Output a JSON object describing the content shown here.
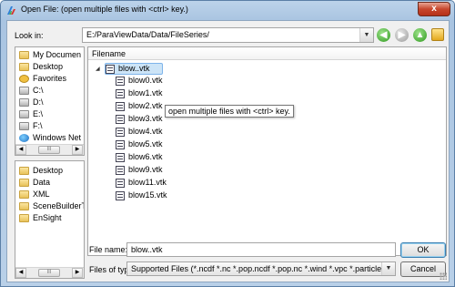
{
  "window": {
    "title": "Open File:  (open multiple files with <ctrl> key.)",
    "close_glyph": "x"
  },
  "toolbar": {
    "look_in_label": "Look in:",
    "look_in_value": "E:/ParaViewData/Data/FileSeries/",
    "back_glyph": "◀",
    "forward_glyph": "▶",
    "up_glyph": "▲"
  },
  "places": {
    "items": [
      {
        "label": "My Documen",
        "icon": "folder"
      },
      {
        "label": "Desktop",
        "icon": "folder"
      },
      {
        "label": "Favorites",
        "icon": "star"
      },
      {
        "label": "C:\\",
        "icon": "drive"
      },
      {
        "label": "D:\\",
        "icon": "drive"
      },
      {
        "label": "E:\\",
        "icon": "drive"
      },
      {
        "label": "F:\\",
        "icon": "drive"
      },
      {
        "label": "Windows Net",
        "icon": "globe"
      }
    ],
    "scroll_thumb": "III"
  },
  "recent": {
    "items": [
      {
        "label": "Desktop",
        "icon": "folder"
      },
      {
        "label": "Data",
        "icon": "folder"
      },
      {
        "label": "XML",
        "icon": "folder"
      },
      {
        "label": "SceneBuilderT",
        "icon": "folder"
      },
      {
        "label": "EnSight",
        "icon": "folder"
      }
    ],
    "scroll_thumb": "III"
  },
  "files": {
    "column_header": "Filename",
    "group": "blow..vtk",
    "children": [
      "blow0.vtk",
      "blow1.vtk",
      "blow2.vtk",
      "blow3.vtk",
      "blow4.vtk",
      "blow5.vtk",
      "blow6.vtk",
      "blow9.vtk",
      "blow11.vtk",
      "blow15.vtk"
    ],
    "tooltip": "open multiple files with <ctrl> key."
  },
  "footer": {
    "file_name_label": "File name:",
    "file_name_value": "blow..vtk",
    "file_type_label": "Files of type:",
    "file_type_value": "Supported Files (*.ncdf *.nc *.pop.ncdf *.pop.nc *.wind *.vpc *.particles *",
    "ok_label": "OK",
    "cancel_label": "Cancel"
  }
}
